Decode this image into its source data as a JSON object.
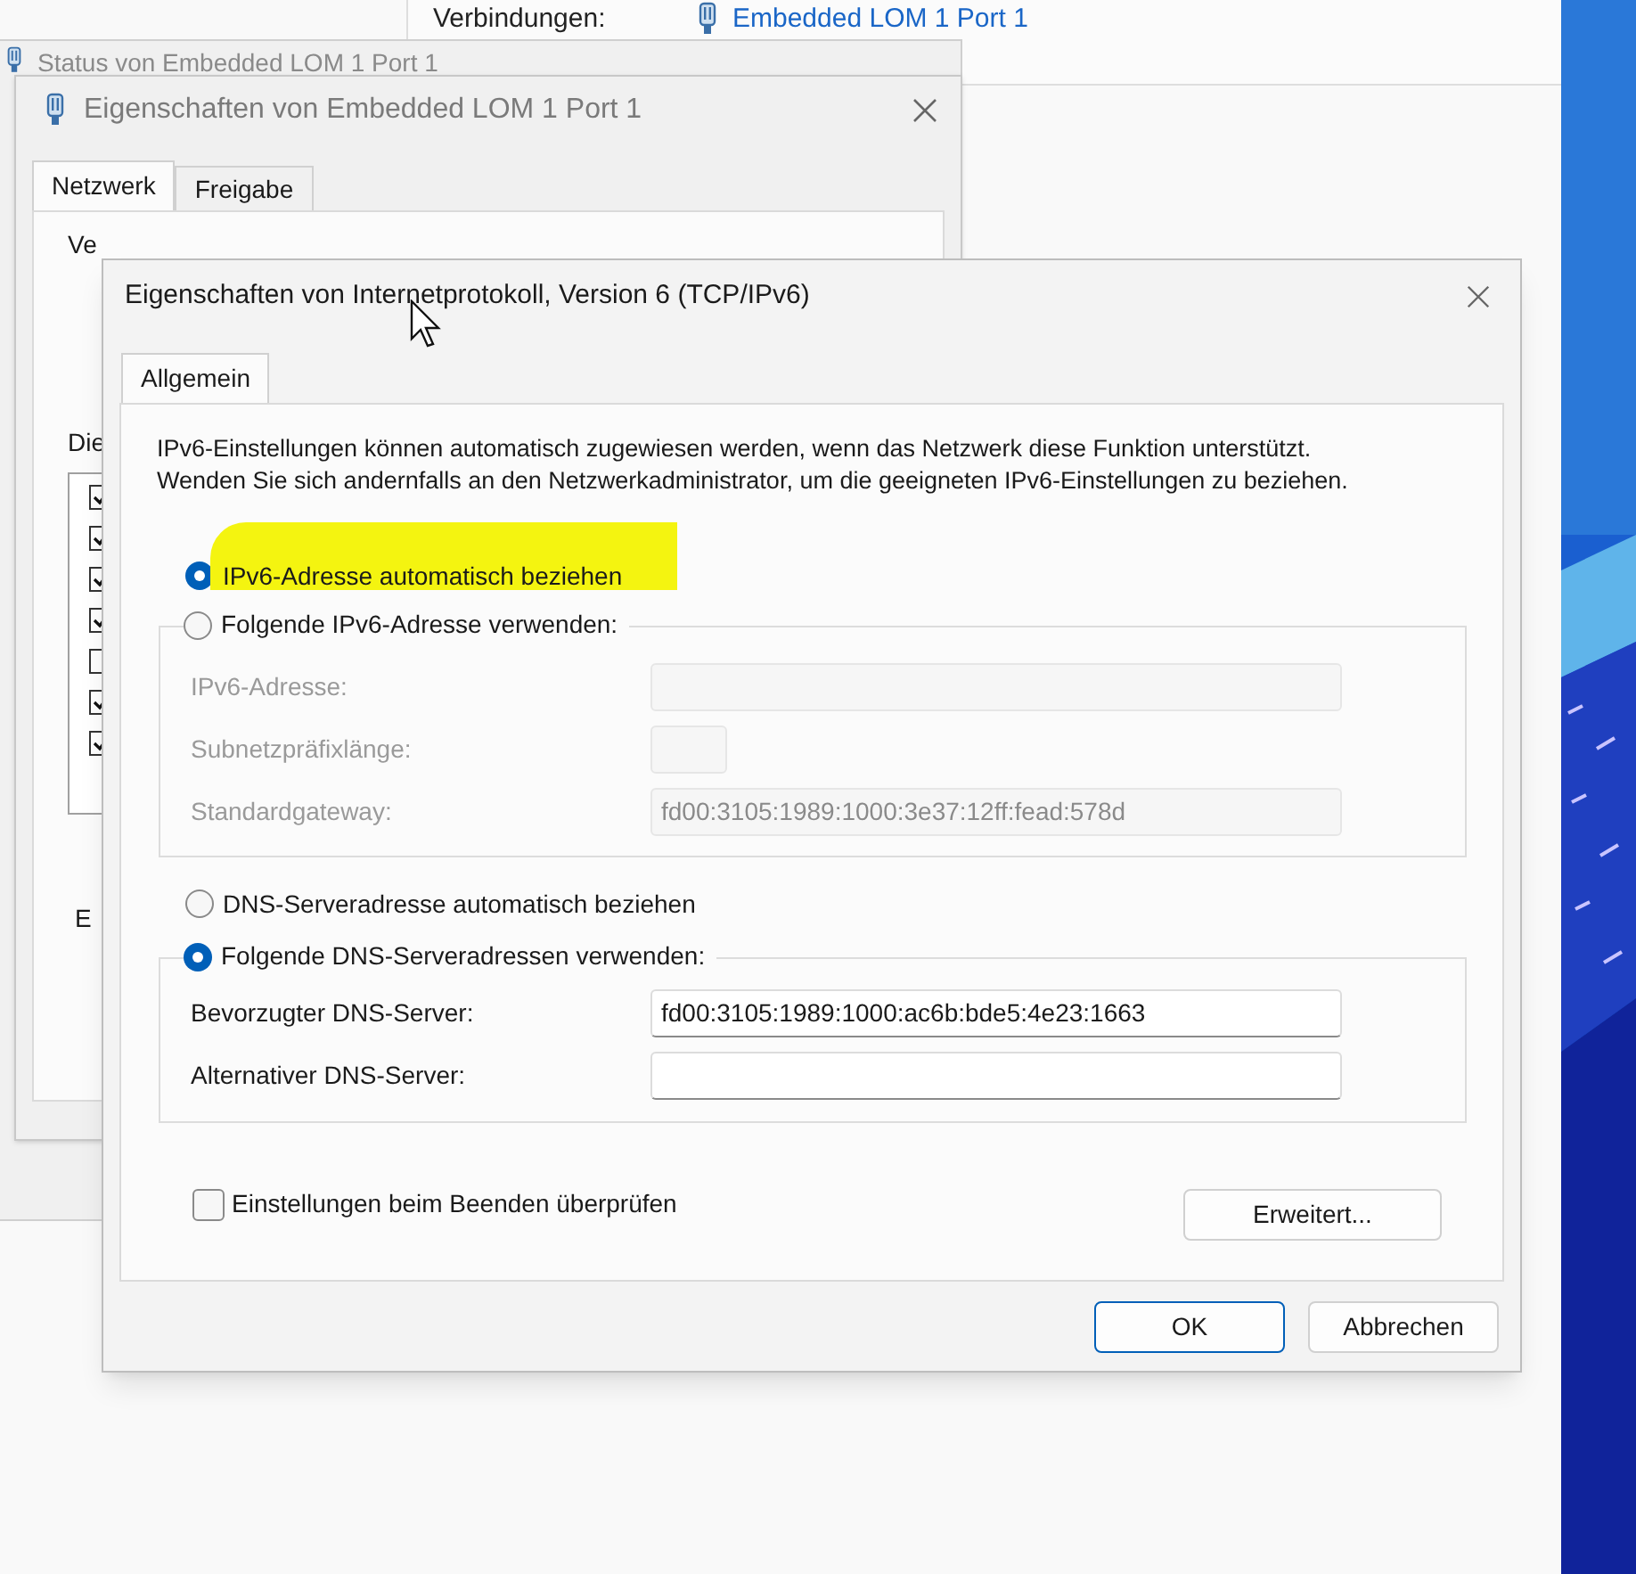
{
  "background_window": {
    "label": "Verbindungen:",
    "link": "Embedded LOM 1 Port 1"
  },
  "status_window": {
    "title": "Status von Embedded LOM 1 Port 1"
  },
  "properties_window": {
    "title": "Eigenschaften von Embedded LOM 1 Port 1",
    "tabs": [
      {
        "label": "Netzwerk",
        "selected": true
      },
      {
        "label": "Freigabe",
        "selected": false
      }
    ],
    "label_1": "Ve",
    "label_2": "Die",
    "components": [
      {
        "checked": true
      },
      {
        "checked": true
      },
      {
        "checked": true
      },
      {
        "checked": true
      },
      {
        "checked": false
      },
      {
        "checked": true
      },
      {
        "checked": true
      }
    ],
    "group_label": "E"
  },
  "ipv6_dialog": {
    "title": "Eigenschaften von Internetprotokoll, Version 6 (TCP/IPv6)",
    "tabs": [
      {
        "label": "Allgemein",
        "selected": true
      }
    ],
    "description": "IPv6-Einstellungen können automatisch zugewiesen werden, wenn das Netzwerk diese Funktion unterstützt. Wenden Sie sich andernfalls an den Netzwerkadministrator, um die geeigneten IPv6-Einstellungen zu beziehen.",
    "address_auto": {
      "label": "IPv6-Adresse automatisch beziehen",
      "selected": true,
      "highlighted": true
    },
    "address_manual": {
      "label": "Folgende IPv6-Adresse verwenden:",
      "selected": false
    },
    "address_fields": [
      {
        "label": "IPv6-Adresse:",
        "disabled": true,
        "kind": "wide"
      },
      {
        "label": "Subnetzpräfixlänge:",
        "disabled": true,
        "kind": "short"
      },
      {
        "label": "Standardgateway:",
        "disabled": true,
        "kind": "wide",
        "value": "fd00:3105:1989:1000:3e37:12ff:fead:578d"
      }
    ],
    "dns_auto": {
      "label": "DNS-Serveradresse automatisch beziehen",
      "selected": false
    },
    "dns_manual": {
      "label": "Folgende DNS-Serveradressen verwenden:",
      "selected": true
    },
    "dns_fields": [
      {
        "label": "Bevorzugter DNS-Server:",
        "disabled": false,
        "value": "fd00:3105:1989:1000:ac6b:bde5:4e23:1663"
      },
      {
        "label": "Alternativer DNS-Server:",
        "disabled": false
      }
    ],
    "validate_checkbox": {
      "label": "Einstellungen beim Beenden überprüfen",
      "checked": false
    },
    "advanced_button": "Erweitert...",
    "buttons": [
      {
        "label": "OK",
        "default": true
      },
      {
        "label": "Abbrechen",
        "default": false
      }
    ]
  }
}
